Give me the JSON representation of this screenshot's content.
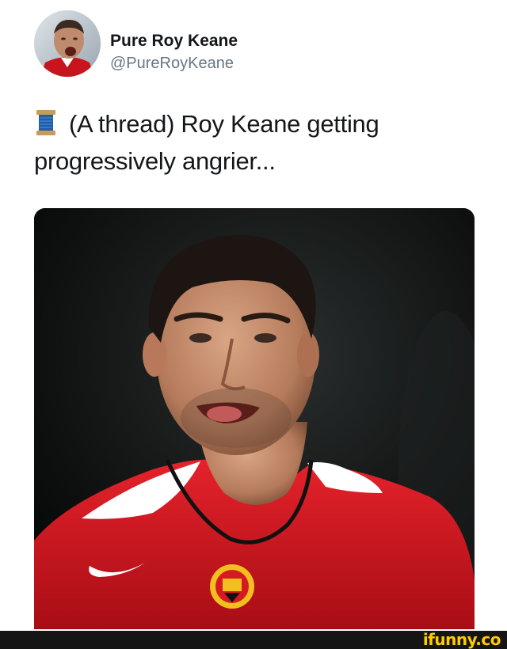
{
  "tweet": {
    "display_name": "Pure Roy Keane",
    "handle": "@PureRoyKeane",
    "text": "(A thread) Roy Keane getting progressively angrier...",
    "leading_icon": "spool-of-thread-icon"
  },
  "watermark": {
    "text": "ifunny.co",
    "color": "#ffcc00"
  },
  "colors": {
    "name": "#14171a",
    "handle": "#657786",
    "shirt": "#d4121c",
    "footer": "#151515"
  }
}
